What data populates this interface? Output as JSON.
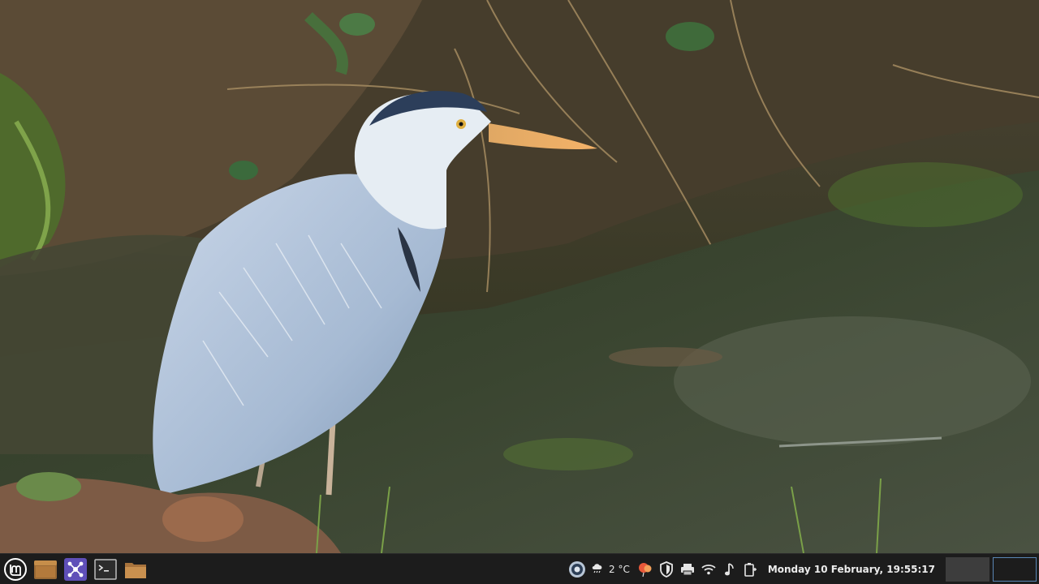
{
  "wallpaper": {
    "icon": "grey-heron-in-pond-photo"
  },
  "panel": {
    "launchers": [
      {
        "name": "menu-button",
        "icon": "linux-mint-logo-icon"
      },
      {
        "name": "file-manager-launcher",
        "icon": "file-manager-icon"
      },
      {
        "name": "software-launcher",
        "icon": "software-hub-icon"
      },
      {
        "name": "terminal-launcher",
        "icon": "terminal-icon"
      },
      {
        "name": "folder-launcher",
        "icon": "folder-icon"
      }
    ],
    "tray": {
      "update_icon": "update-manager-icon",
      "weather": {
        "icon": "cloud-rain-icon",
        "temperature": "2 °C"
      },
      "icons": [
        "notification-balloon-icon",
        "shield-icon",
        "printer-icon",
        "wifi-icon",
        "music-note-icon",
        "battery-plug-icon"
      ]
    },
    "clock": "Monday 10 February, 19:55:17",
    "workspaces": [
      {
        "name": "workspace-1",
        "active": false
      },
      {
        "name": "workspace-2",
        "active": true
      }
    ],
    "colors": {
      "panel_background": "#1c1c1c",
      "clock_text": "#ececec",
      "active_workspace_border": "#5a86b5",
      "inactive_workspace": "#3d3d3d"
    }
  }
}
